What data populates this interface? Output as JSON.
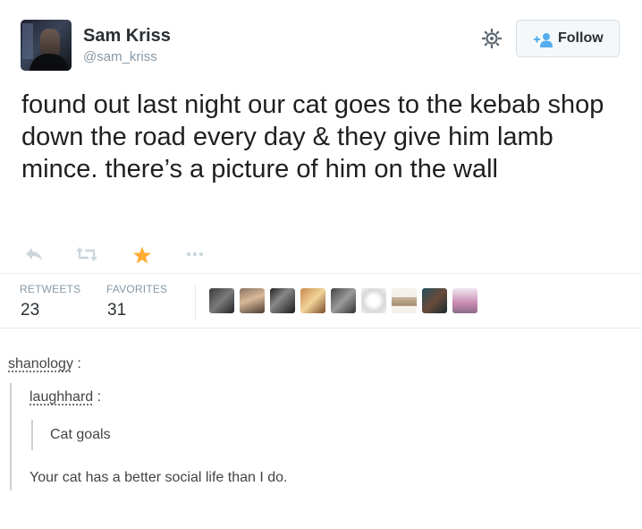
{
  "tweet": {
    "author_name": "Sam Kriss",
    "author_handle": "@sam_kriss",
    "follow_label": "Follow",
    "text": "found out last night our cat goes to the kebab shop down the road every day & they give him lamb mince. there’s a picture of him on the wall",
    "actions": {
      "reply_icon": "reply-arrow-icon",
      "retweet_icon": "retweet-icon",
      "favorite_icon": "star-icon",
      "more_icon": "ellipsis-icon"
    },
    "stats": {
      "retweets_label": "RETWEETS",
      "retweets_count": "23",
      "favorites_label": "FAVORITES",
      "favorites_count": "31"
    },
    "favoriters_count_shown": 9,
    "colors": {
      "star": "#ffac33",
      "muted": "#8899a6",
      "text": "#292f33"
    }
  },
  "tumblr": {
    "user1": "shanology",
    "user1_suffix": ":",
    "user2": "laughhard",
    "user2_suffix": ":",
    "inner_quote": "Cat goals",
    "reply": "Your cat has a better social life than I do."
  }
}
